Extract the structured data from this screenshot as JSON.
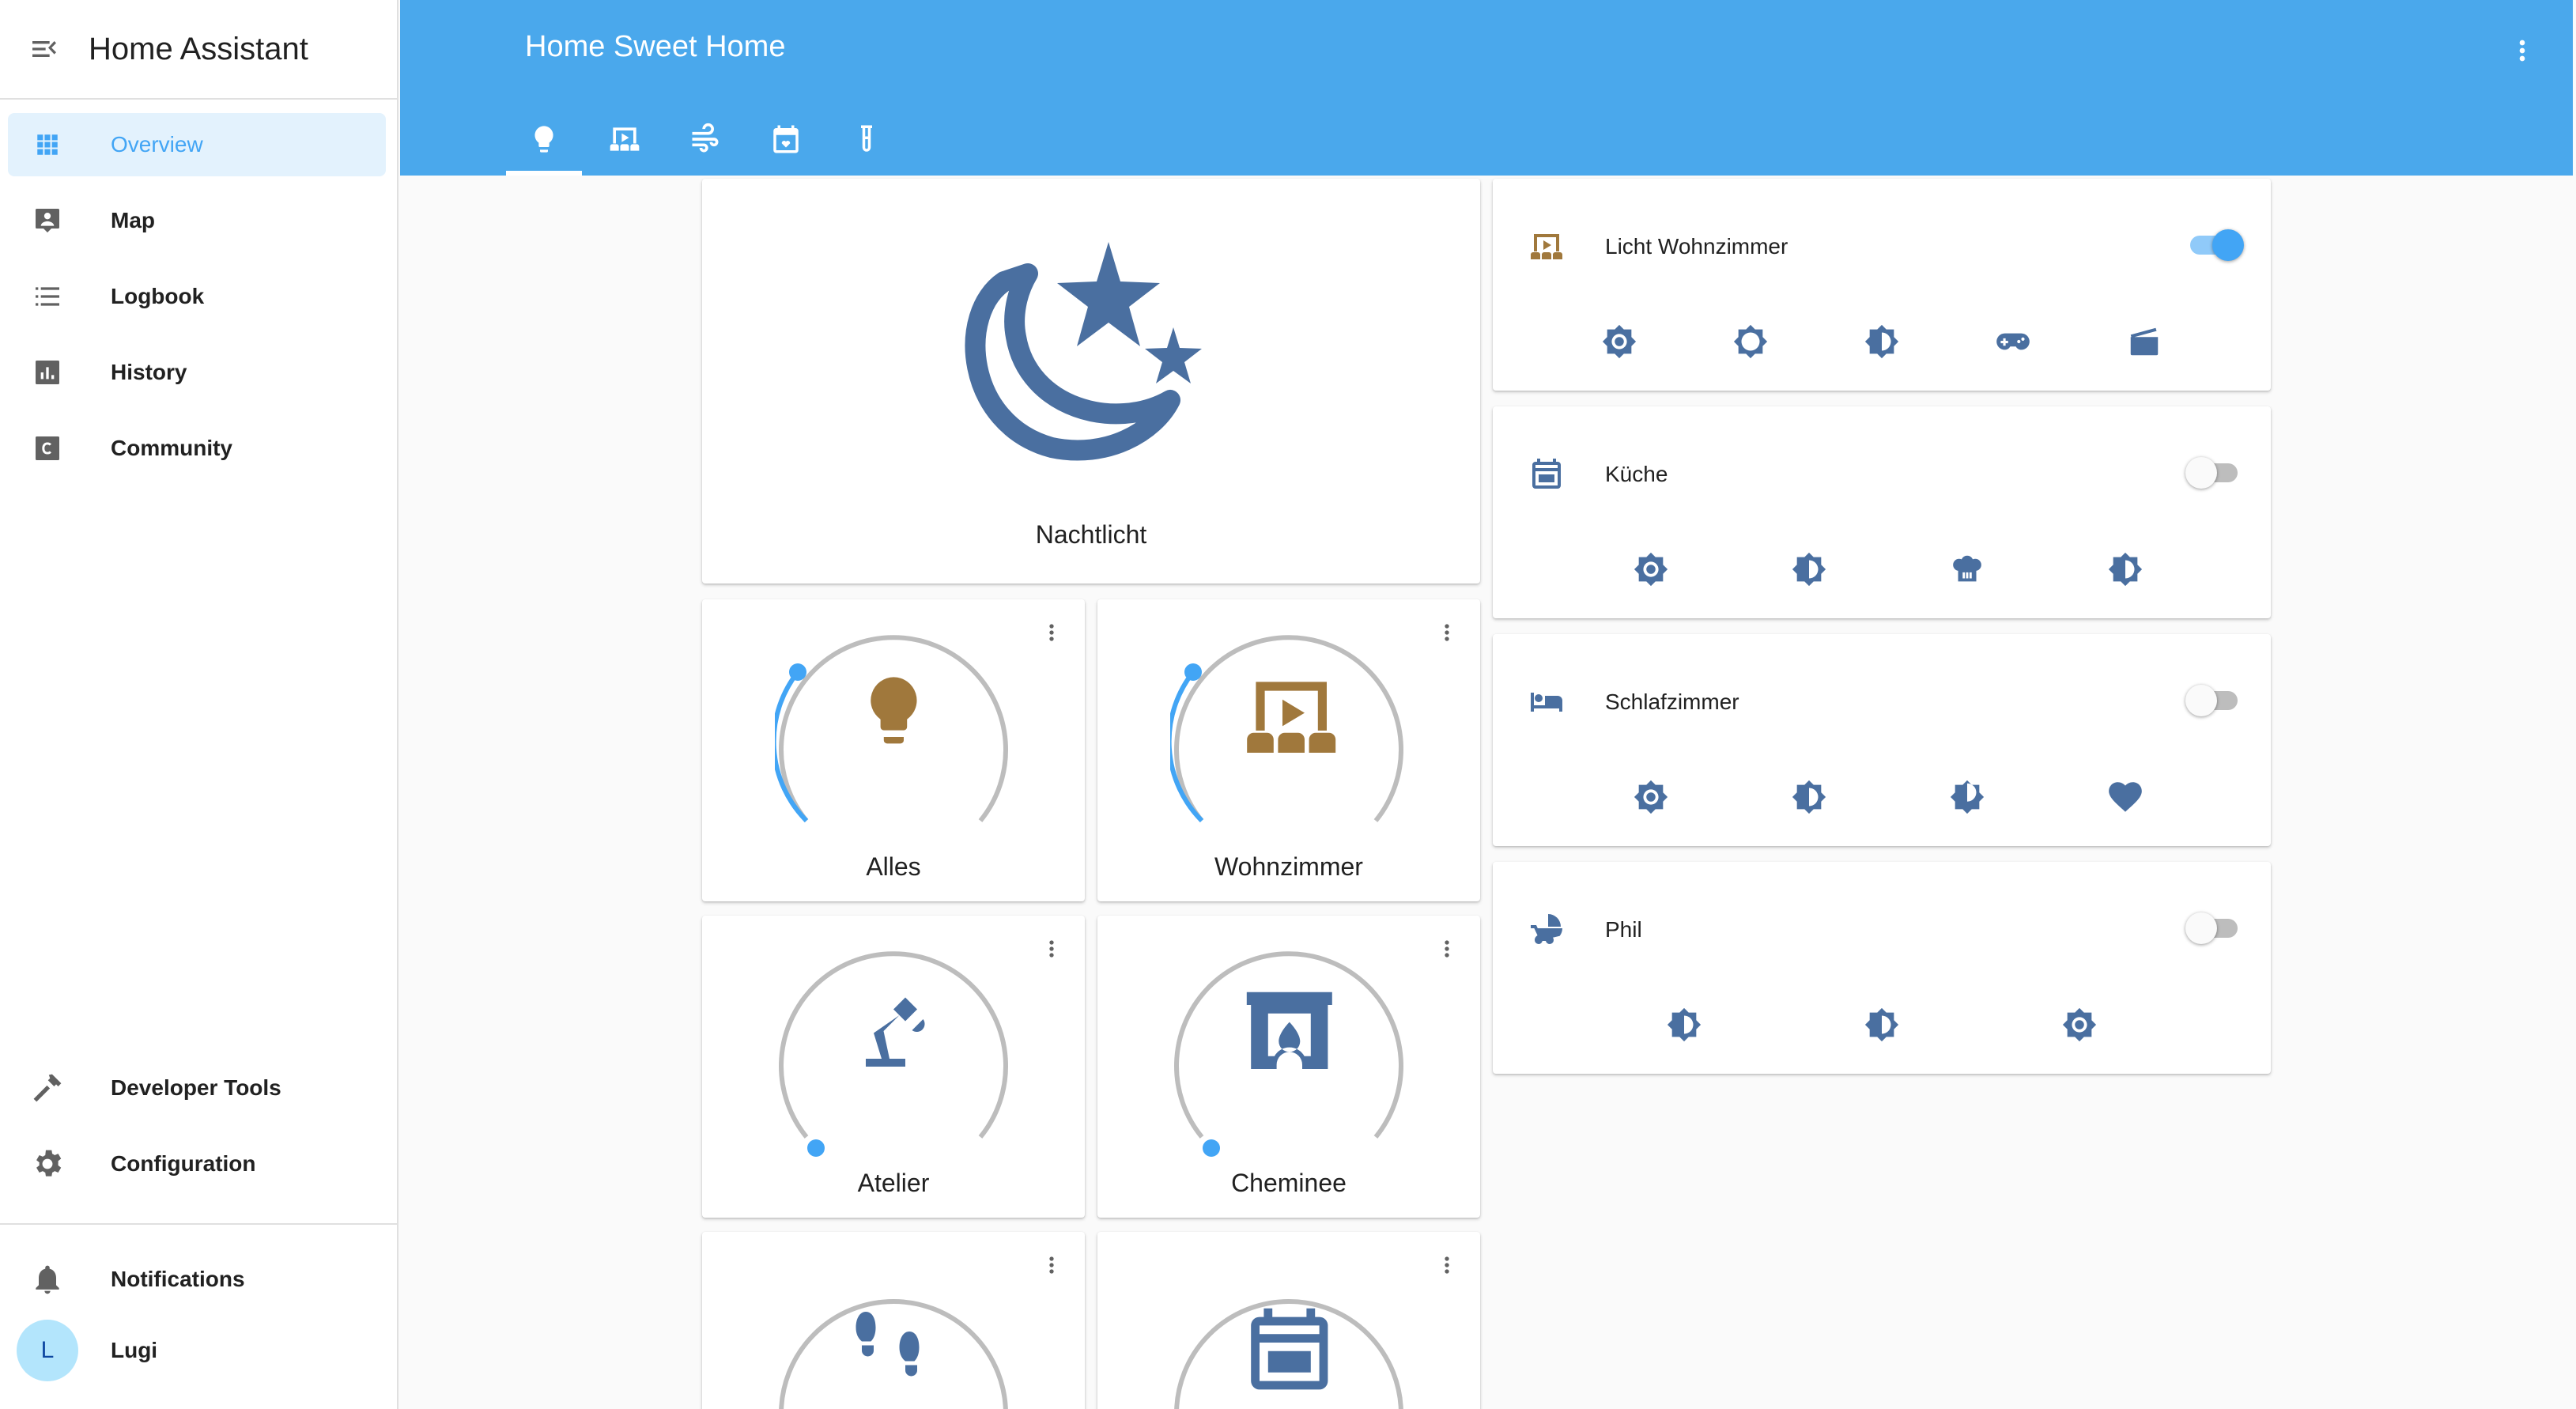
{
  "app": {
    "title": "Home Assistant"
  },
  "sidebar": {
    "items": [
      {
        "label": "Overview",
        "icon": "grid-icon"
      },
      {
        "label": "Map",
        "icon": "map-icon"
      },
      {
        "label": "Logbook",
        "icon": "list-icon"
      },
      {
        "label": "History",
        "icon": "chart-icon"
      },
      {
        "label": "Community",
        "icon": "community-icon"
      }
    ],
    "bottom_items": [
      {
        "label": "Developer Tools",
        "icon": "hammer-icon"
      },
      {
        "label": "Configuration",
        "icon": "gear-icon"
      }
    ],
    "notifications": {
      "label": "Notifications"
    },
    "user": {
      "name": "Lugi",
      "initial": "L"
    }
  },
  "header": {
    "title": "Home Sweet Home",
    "tabs": [
      "lightbulb-icon",
      "theater-icon",
      "fan-icon",
      "calendar-icon",
      "flask-icon"
    ],
    "active_tab": 0
  },
  "cards": {
    "nachtlicht": {
      "label": "Nachtlicht",
      "icon": "moon-stars-icon"
    },
    "lights": [
      {
        "label": "Alles",
        "icon": "lightbulb-icon",
        "state": "on",
        "brightness": 0.25
      },
      {
        "label": "Wohnzimmer",
        "icon": "theater-icon",
        "state": "on",
        "brightness": 0.25
      },
      {
        "label": "Atelier",
        "icon": "desk-lamp-icon",
        "state": "off",
        "brightness": 0.0
      },
      {
        "label": "Cheminee",
        "icon": "fireplace-icon",
        "state": "off",
        "brightness": 0.0
      },
      {
        "label": "",
        "icon": "shoe-print-icon",
        "state": "off"
      },
      {
        "label": "",
        "icon": "stove-icon",
        "state": "off"
      }
    ]
  },
  "rooms": [
    {
      "name": "Licht Wohnzimmer",
      "icon": "theater-icon",
      "on": true,
      "scenes": [
        "brightness-icon",
        "brightness-icon",
        "brightness-half-icon",
        "gamepad-icon",
        "movie-icon"
      ]
    },
    {
      "name": "Küche",
      "icon": "stove-icon",
      "on": false,
      "scenes": [
        "brightness-icon",
        "brightness-half-icon",
        "chef-hat-icon",
        "brightness-half-icon"
      ]
    },
    {
      "name": "Schlafzimmer",
      "icon": "bed-icon",
      "on": false,
      "scenes": [
        "brightness-icon",
        "brightness-half-icon",
        "brightness-half-icon",
        "heart-icon"
      ]
    },
    {
      "name": "Phil",
      "icon": "stroller-icon",
      "on": false,
      "scenes": [
        "brightness-half-icon",
        "brightness-half-icon",
        "brightness-icon"
      ]
    }
  ],
  "colors": {
    "primary": "#4aa8ec",
    "accent": "#42a5f5",
    "icon_blue": "#4a6fa0",
    "icon_on": "#a0783c",
    "sidebar_icon": "#757575"
  }
}
